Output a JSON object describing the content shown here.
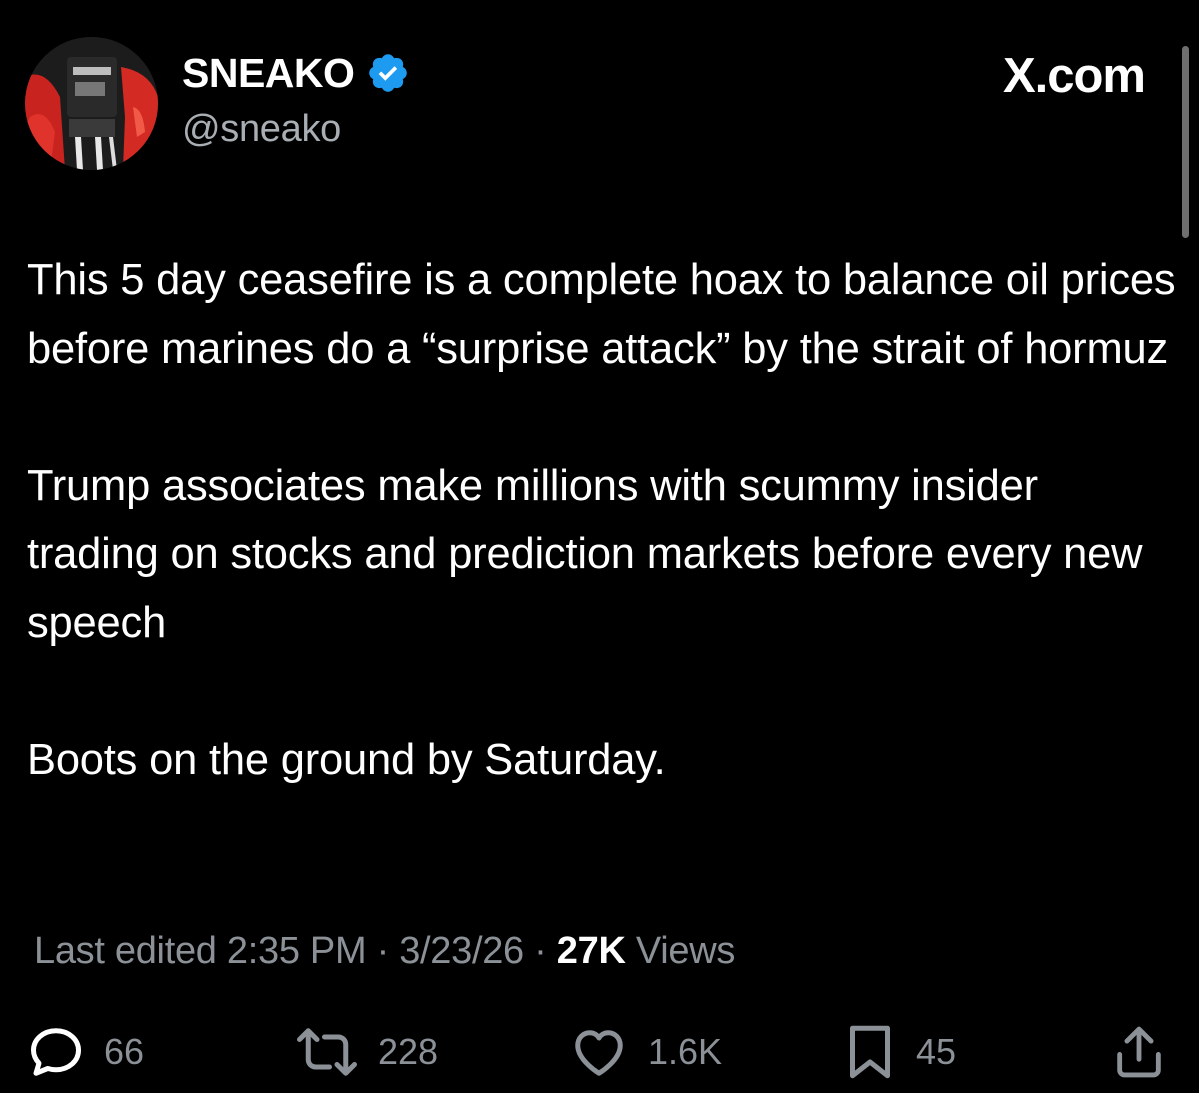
{
  "author": {
    "display_name": "SNEAKO",
    "handle": "@sneako",
    "verified": true,
    "avatar_icon": "profile-avatar"
  },
  "site": {
    "logo_text": "X.com"
  },
  "tweet": {
    "paragraphs": [
      "This 5 day ceasefire is a complete hoax to balance oil prices before marines do a “surprise attack” by the strait of hormuz",
      "Trump associates make millions with scummy insider trading on stocks and prediction markets before every new speech",
      "Boots on the ground by Saturday."
    ],
    "edited_label": "Last edited",
    "time": "2:35 PM",
    "date": "3/23/26",
    "separator": "·",
    "views_count": "27K",
    "views_label": "Views"
  },
  "actions": {
    "reply": {
      "icon": "reply-icon",
      "count": "66"
    },
    "repost": {
      "icon": "repost-icon",
      "count": "228"
    },
    "like": {
      "icon": "heart-icon",
      "count": "1.6K"
    },
    "bookmark": {
      "icon": "bookmark-icon",
      "count": "45"
    },
    "share": {
      "icon": "share-icon"
    }
  },
  "colors": {
    "background": "#000000",
    "text_primary": "#ffffff",
    "text_secondary": "#8b9197",
    "verified_blue": "#1d9bf0"
  }
}
